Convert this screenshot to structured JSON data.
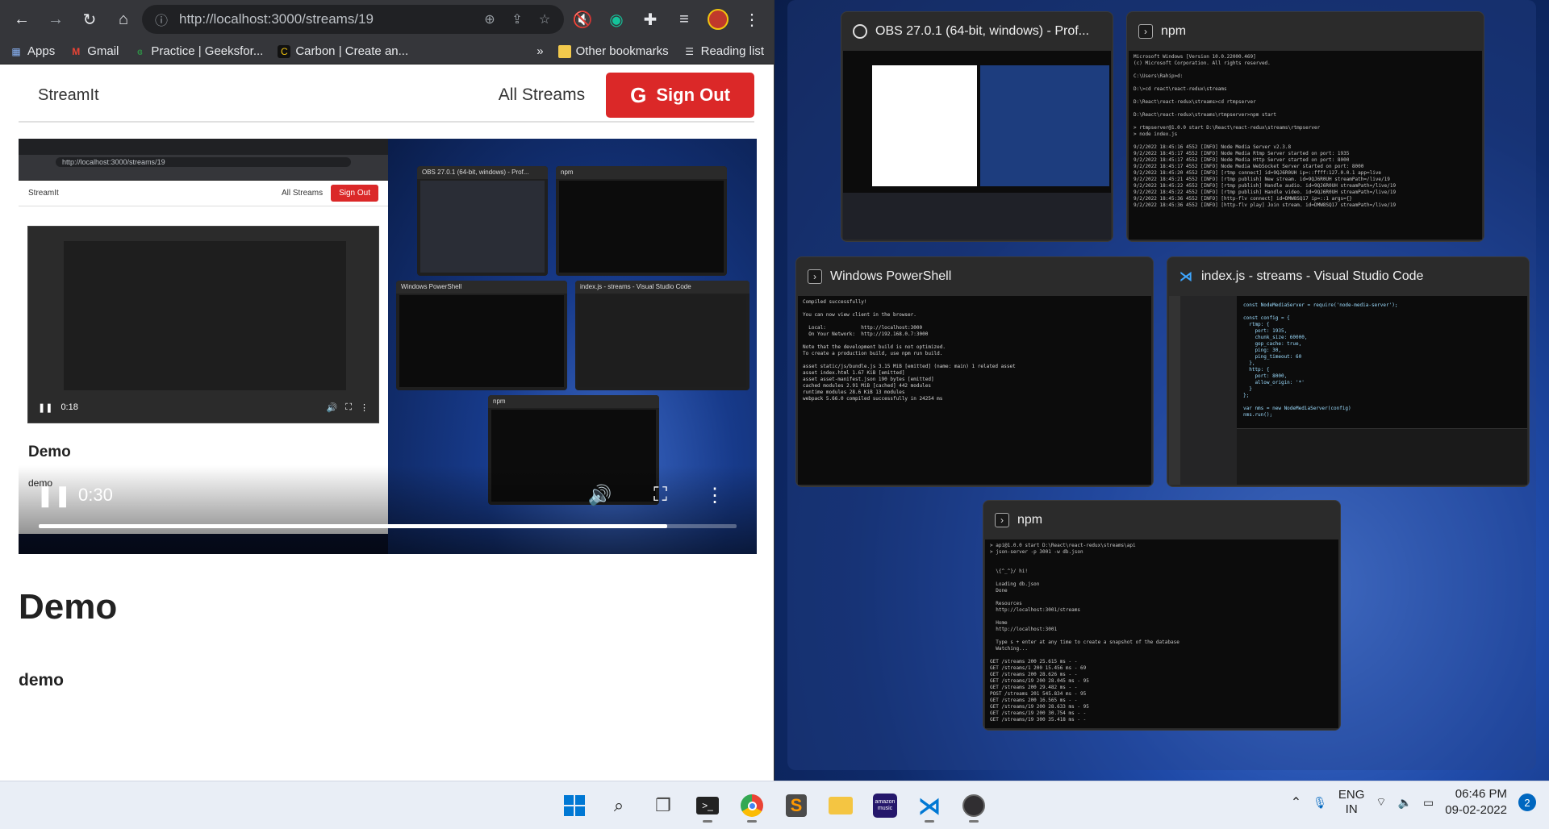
{
  "browser": {
    "url": "http://localhost:3000/streams/19",
    "bookmarks": [
      {
        "label": "Apps",
        "icon": "apps-grid-icon"
      },
      {
        "label": "Gmail",
        "icon": "gmail-icon"
      },
      {
        "label": "Practice | Geeksfor...",
        "icon": "geeksforgeeks-icon"
      },
      {
        "label": "Carbon | Create an...",
        "icon": "carbon-icon"
      }
    ],
    "bookmarks_more": "»",
    "other_bookmarks": "Other bookmarks",
    "reading_list": "Reading list"
  },
  "app": {
    "brand": "StreamIt",
    "all_streams": "All Streams",
    "sign_out": "Sign Out",
    "stream_title": "Demo",
    "stream_description": "demo"
  },
  "video": {
    "current_time": "0:30",
    "progress": 0.9,
    "mini": {
      "url": "http://localhost:3000/streams/19",
      "brand": "StreamIt",
      "all_streams": "All Streams",
      "sign_out": "Sign Out",
      "time": "0:18",
      "title": "Demo",
      "desc": "demo"
    },
    "mini_windows": [
      {
        "title": "OBS 27.0.1 (64-bit, windows) - Prof..."
      },
      {
        "title": "npm"
      },
      {
        "title": "Windows PowerShell"
      },
      {
        "title": "index.js - streams - Visual Studio Code"
      },
      {
        "title": "npm"
      }
    ]
  },
  "snap_windows": {
    "obs": {
      "title": "OBS 27.0.1 (64-bit, windows) - Prof..."
    },
    "npm1": {
      "title": "npm"
    },
    "powershell": {
      "title": "Windows PowerShell"
    },
    "vscode": {
      "title": "index.js - streams - Visual Studio Code"
    },
    "npm2": {
      "title": "npm"
    }
  },
  "terminal_text": {
    "npm1": "Microsoft Windows [Version 10.0.22000.469]\n(c) Microsoft Corporation. All rights reserved.\n\nC:\\Users\\Rahip>d:\n\nD:\\>cd react\\react-redux\\streams\n\nD:\\React\\react-redux\\streams>cd rtmpserver\n\nD:\\React\\react-redux\\streams\\rtmpserver>npm start\n\n> rtmpserver@1.0.0 start D:\\React\\react-redux\\streams\\rtmpserver\n> node index.js\n\n9/2/2022 18:45:16 4552 [INFO] Node Media Server v2.3.8\n9/2/2022 18:45:17 4552 [INFO] Node Media Rtmp Server started on port: 1935\n9/2/2022 18:45:17 4552 [INFO] Node Media Http Server started on port: 8000\n9/2/2022 18:45:17 4552 [INFO] Node Media WebSocket Server started on port: 8000\n9/2/2022 18:45:20 4552 [INFO] [rtmp connect] id=9QJ6R0UH ip=::ffff:127.0.0.1 app=live\n9/2/2022 18:45:21 4552 [INFO] [rtmp publish] New stream. id=9QJ6R0UH streamPath=/live/19\n9/2/2022 18:45:22 4552 [INFO] [rtmp publish] Handle audio. id=9QJ6R0UH streamPath=/live/19\n9/2/2022 18:45:22 4552 [INFO] [rtmp publish] Handle video. id=9QJ6R0UH streamPath=/live/19\n9/2/2022 18:45:36 4552 [INFO] [http-flv connect] id=DMW8SQ17 ip=::1 args={}\n9/2/2022 18:45:36 4552 [INFO] [http-flv play] Join stream. id=DMW8SQ17 streamPath=/live/19",
    "powershell": "Compiled successfully!\n\nYou can now view client in the browser.\n\n  Local:            http://localhost:3000\n  On Your Network:  http://192.168.0.7:3000\n\nNote that the development build is not optimized.\nTo create a production build, use npm run build.\n\nasset static/js/bundle.js 3.15 MiB [emitted] (name: main) 1 related asset\nasset index.html 1.67 KiB [emitted]\nasset asset-manifest.json 190 bytes [emitted]\ncached modules 2.91 MiB [cached] 442 modules\nruntime modules 28.6 KiB 13 modules\nwebpack 5.66.0 compiled successfully in 24254 ms",
    "npm2": "> api@1.0.0 start D:\\React\\react-redux\\streams\\api\n> json-server -p 3001 -w db.json\n\n\n  \\{^_^}/ hi!\n\n  Loading db.json\n  Done\n\n  Resources\n  http://localhost:3001/streams\n\n  Home\n  http://localhost:3001\n\n  Type s + enter at any time to create a snapshot of the database\n  Watching...\n\nGET /streams 200 25.615 ms - -\nGET /streams/1 200 15.456 ms - 69\nGET /streams 200 28.626 ms - -\nGET /streams/19 200 28.045 ms - 95\nGET /streams 200 29.482 ms - -\nPOST /streams 201 545.834 ms - 95\nGET /streams 200 16.565 ms - -\nGET /streams/19 200 28.633 ms - 95\nGET /streams/19 200 30.754 ms - -\nGET /streams/19 300 35.418 ms - -",
    "vscode": "const NodeMediaServer = require('node-media-server');\n\nconst config = {\n  rtmp: {\n    port: 1935,\n    chunk_size: 60000,\n    gop_cache: true,\n    ping: 30,\n    ping_timeout: 60\n  },\n  http: {\n    port: 8000,\n    allow_origin: '*'\n  }\n};\n\nvar nms = new NodeMediaServer(config)\nnms.run();"
  },
  "taskbar": {
    "lang_top": "ENG",
    "lang_bottom": "IN",
    "time": "06:46 PM",
    "date": "09-02-2022",
    "notifications": "2",
    "apps": [
      "windows-start-icon",
      "search-icon",
      "task-view-icon",
      "terminal-icon",
      "chrome-icon",
      "sublime-text-icon",
      "file-explorer-icon",
      "amazon-music-icon",
      "vscode-icon",
      "obs-icon"
    ]
  },
  "colors": {
    "signout": "#db2828",
    "chrome_dark": "#35363a",
    "taskbar": "#e9eef6"
  }
}
